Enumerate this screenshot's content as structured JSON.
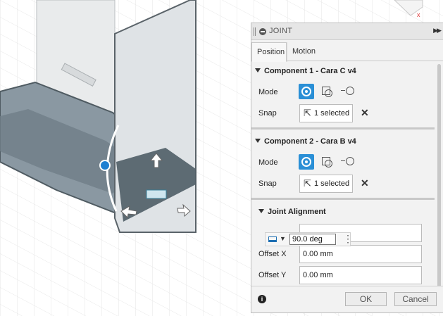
{
  "panel": {
    "title": "JOINT",
    "tabs": [
      {
        "label": "Position"
      },
      {
        "label": "Motion"
      }
    ],
    "component1": {
      "header": "Component 1 - Cara C v4",
      "mode_label": "Mode",
      "snap_label": "Snap",
      "snap_value": "1 selected"
    },
    "component2": {
      "header": "Component 2 - Cara B v4",
      "mode_label": "Mode",
      "snap_label": "Snap",
      "snap_value": "1 selected"
    },
    "alignment": {
      "header": "Joint Alignment",
      "offset_x_label": "Offset X",
      "offset_x_value": "0.00 mm",
      "offset_y_label": "Offset Y",
      "offset_y_value": "0.00 mm"
    },
    "footer": {
      "ok_label": "OK",
      "cancel_label": "Cancel"
    }
  },
  "angle_input": {
    "value": "90.0 deg"
  },
  "colors": {
    "accent": "#2a8fd6",
    "manipulator": "#1e7fd1",
    "model_face": "#5d6f7a"
  },
  "icons": {
    "info": "i",
    "expand": "▶▶",
    "clear": "✕",
    "cursor": "pointer"
  }
}
